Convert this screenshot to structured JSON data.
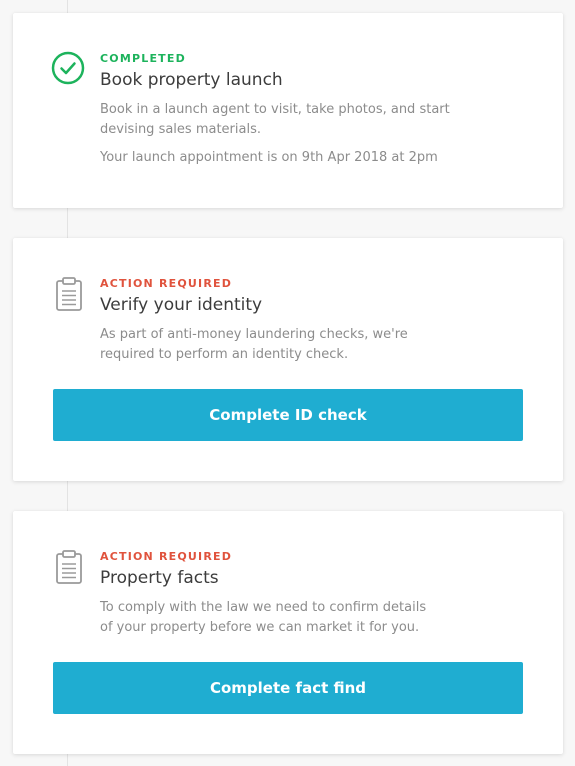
{
  "cards": [
    {
      "status": "COMPLETED",
      "status_icon": "check-circle-icon",
      "title": "Book property launch",
      "description_lines": [
        "Book in a launch agent to visit, take photos, and start",
        "devising sales materials."
      ],
      "note": "Your launch appointment is on 9th Apr 2018 at 2pm"
    },
    {
      "status": "ACTION REQUIRED",
      "status_icon": "clipboard-icon",
      "title": "Verify your identity",
      "description_lines": [
        "As part of anti-money laundering checks, we're",
        "required to perform an identity check."
      ],
      "button_label": "Complete ID check"
    },
    {
      "status": "ACTION REQUIRED",
      "status_icon": "clipboard-icon",
      "title": "Property facts",
      "description_lines": [
        "To comply with the law we need to confirm details",
        "of your property before we can market it for you."
      ],
      "button_label": "Complete fact find"
    }
  ],
  "colors": {
    "completed": "#1db35c",
    "action_required": "#e0533d",
    "button": "#1fadd1",
    "title": "#3c3c3c",
    "body_text": "#8c8c8c",
    "background": "#f7f7f7"
  }
}
